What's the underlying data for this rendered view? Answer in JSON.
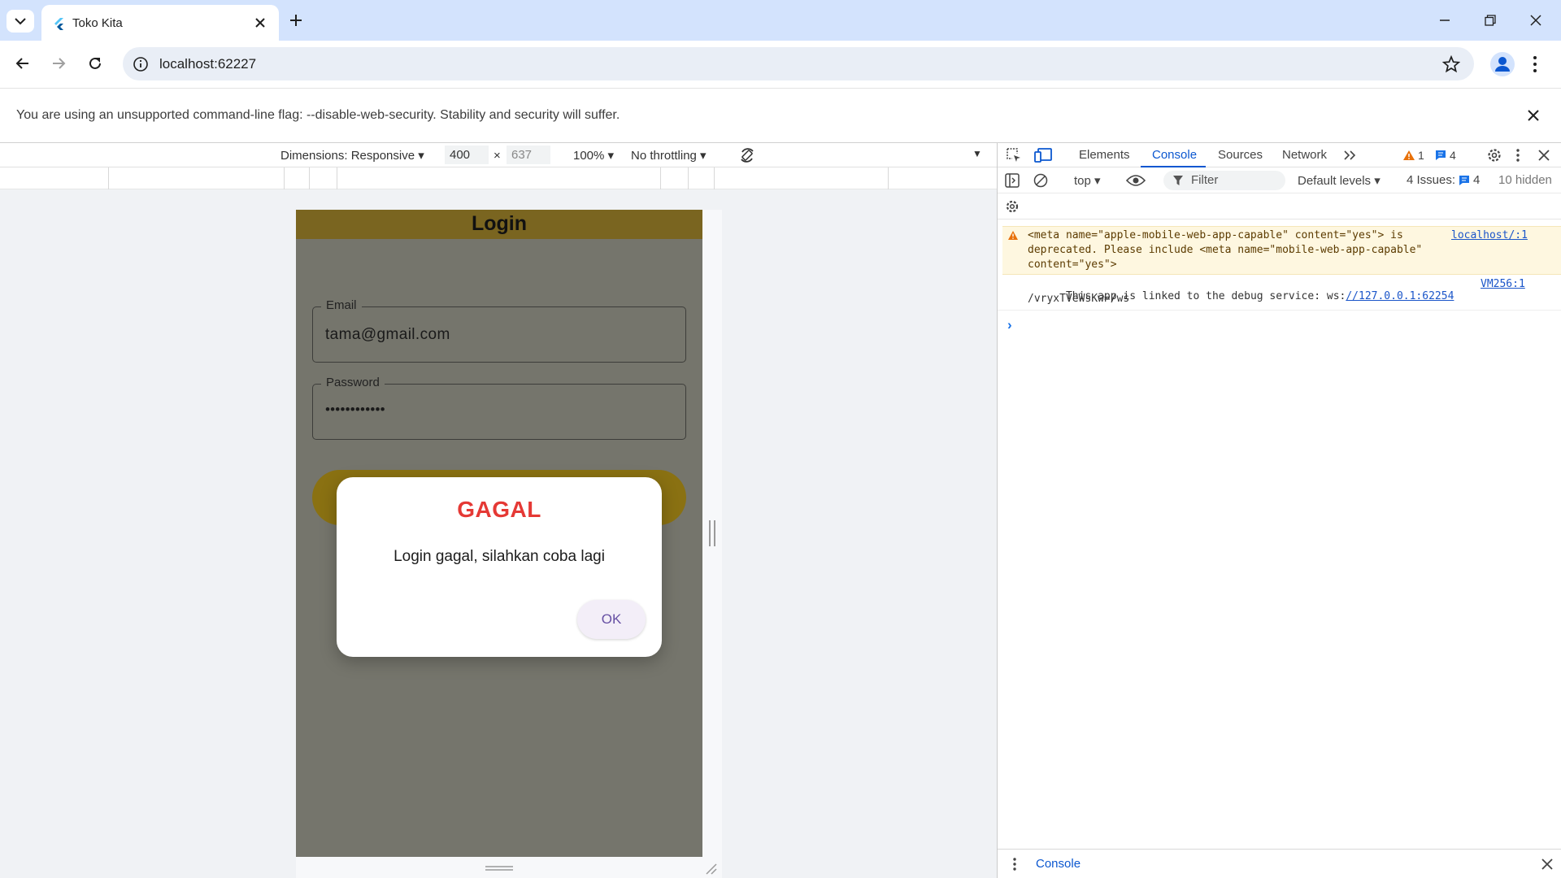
{
  "browser": {
    "tab_title": "Toko Kita",
    "url": "localhost:62227",
    "infobar_message": "You are using an unsupported command-line flag: --disable-web-security. Stability and security will suffer."
  },
  "device_toolbar": {
    "dimensions": "Dimensions: Responsive",
    "width": "400",
    "times": "×",
    "height": "637",
    "zoom": "100%",
    "throttling": "No throttling"
  },
  "app": {
    "title": "Login",
    "email_label": "Email",
    "email_value": "tama@gmail.com",
    "password_label": "Password",
    "password_value": "••••••••••••"
  },
  "dialog": {
    "title": "GAGAL",
    "message": "Login gagal, silahkan coba lagi",
    "ok_label": "OK"
  },
  "devtools": {
    "tabs": [
      "Elements",
      "Console",
      "Sources",
      "Network"
    ],
    "active_tab": "Console",
    "warning_count": "1",
    "message_count": "4",
    "context": "top",
    "filter_placeholder": "Filter",
    "levels": "Default levels",
    "issues_label": "4 Issues:",
    "issues_count": "4",
    "hidden": "10 hidden",
    "warning_line1": "<meta name=\"apple-mobile-web-app-capable\" content=\"yes\"> is",
    "warning_line2": "deprecated. Please include <meta name=\"mobile-web-app-capable\"",
    "warning_line3": "content=\"yes\">",
    "warning_source": "localhost/:1",
    "info_prefix": "This app is linked to the debug service: ws:",
    "info_link": "//127.0.0.1:62254",
    "info_line2": "/vryxTVeWsKw=/ws",
    "info_source": "VM256:1",
    "prompt": "›",
    "footer_tab": "Console"
  },
  "colors": {
    "accent": "#0b57d0",
    "appbar": "#7a6520",
    "dialog_title": "#e53935",
    "button": "#8a7112"
  }
}
